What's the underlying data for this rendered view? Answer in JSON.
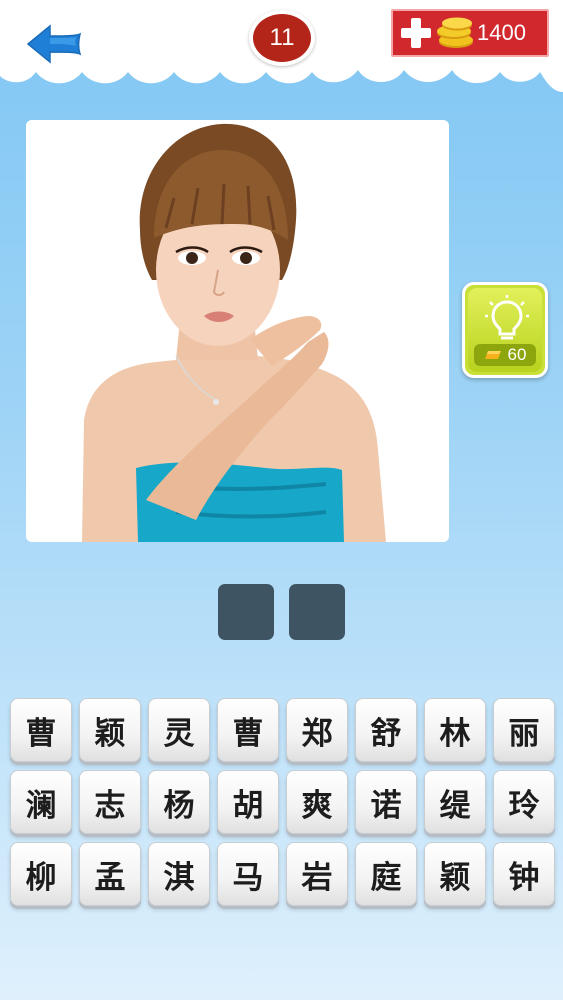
{
  "header": {
    "back_icon": "arrow-left-icon",
    "level": "11",
    "coins": "1400",
    "add_icon": "plus-icon",
    "coin_icon": "coin-stack-icon",
    "colors": {
      "cloud": "#ffffff",
      "badge": "#b42519",
      "coin_box": "#d1282e"
    }
  },
  "puzzle": {
    "photo_icon": "portrait-photo",
    "hint": {
      "icon": "lightbulb-icon",
      "cost": "60",
      "cost_icon": "gold-icon"
    },
    "answer_slots": [
      "",
      ""
    ]
  },
  "keyboard": {
    "keys": [
      "曹",
      "颖",
      "灵",
      "曹",
      "郑",
      "舒",
      "林",
      "丽",
      "澜",
      "志",
      "杨",
      "胡",
      "爽",
      "诺",
      "缇",
      "玲",
      "柳",
      "孟",
      "淇",
      "马",
      "岩",
      "庭",
      "颖",
      "钟"
    ]
  }
}
